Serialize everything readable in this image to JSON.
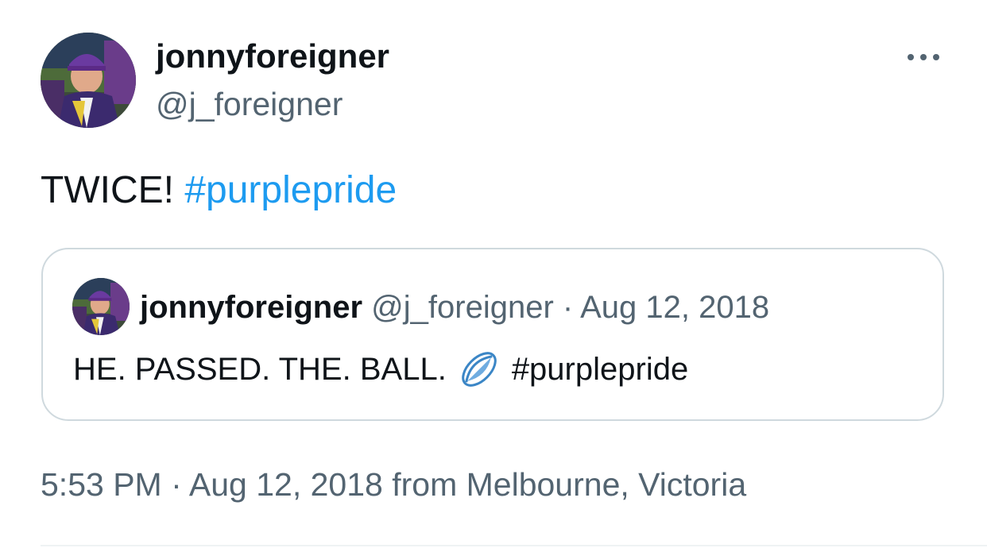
{
  "author": {
    "display_name": "jonnyforeigner",
    "handle": "@j_foreigner"
  },
  "tweet": {
    "text": "TWICE!",
    "hashtag": "#purplepride"
  },
  "quoted_tweet": {
    "display_name": "jonnyforeigner",
    "handle": "@j_foreigner",
    "separator": " · ",
    "date": "Aug 12, 2018",
    "text": "HE. PASSED. THE. BALL.",
    "emoji_icon": "rugby-ball-icon",
    "hashtag": "#purplepride"
  },
  "timestamp": {
    "time": "5:53 PM",
    "separator": " · ",
    "date": "Aug 12, 2018",
    "source": "from Melbourne, Victoria"
  },
  "icons": {
    "more": "more-options-icon"
  },
  "colors": {
    "hashtag": "#1d9bf0",
    "secondary_text": "#536471",
    "border": "#cfd9de",
    "team_purple": "#5b2a86"
  }
}
